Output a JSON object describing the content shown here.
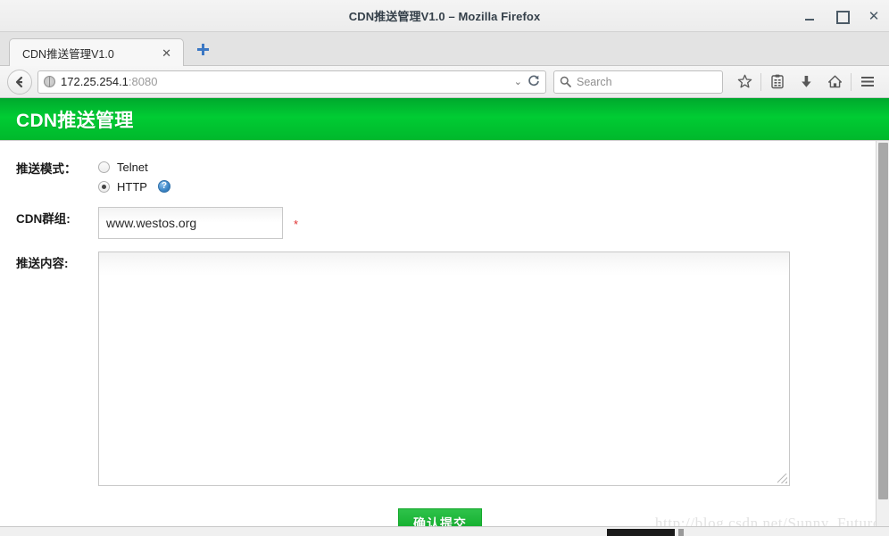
{
  "window": {
    "title": "CDN推送管理V1.0 – Mozilla Firefox",
    "minimize_label": "_",
    "maximize_label": "□",
    "close_label": "✕"
  },
  "tabs": {
    "items": [
      {
        "label": "CDN推送管理V1.0",
        "close_label": "✕",
        "active": true
      }
    ],
    "new_tab_label": "✛"
  },
  "navbar": {
    "back_label": "❮",
    "url_host": "172.25.254.1",
    "url_port": ":8080",
    "dropdown_label": "⌄",
    "reload_label": "⟳",
    "search_placeholder": "Search",
    "search_value": "",
    "search_icon_label": "⌕",
    "icons": [
      {
        "name": "bookmark-star-icon",
        "glyph": "☆"
      },
      {
        "name": "library-icon",
        "glyph": "▤"
      },
      {
        "name": "downloads-icon",
        "glyph": "⬇"
      },
      {
        "name": "home-icon",
        "glyph": "⌂"
      },
      {
        "name": "menu-icon",
        "glyph": "☰"
      }
    ]
  },
  "page": {
    "banner_title": "CDN推送管理",
    "banner_color": "#00cc33",
    "form": {
      "mode": {
        "label": "推送模式：",
        "options": [
          {
            "value": "telnet",
            "label": "Telnet",
            "selected": false
          },
          {
            "value": "http",
            "label": "HTTP",
            "selected": true
          }
        ],
        "help_glyph": "?"
      },
      "group": {
        "label": "CDN群组:",
        "value": "www.westos.org",
        "placeholder": "",
        "required_marker": "*"
      },
      "content": {
        "label": "推送内容:",
        "value": "",
        "placeholder": ""
      },
      "submit_label": "确认提交"
    },
    "watermark": "http://blog.csdn.net/Sunny_Future"
  }
}
